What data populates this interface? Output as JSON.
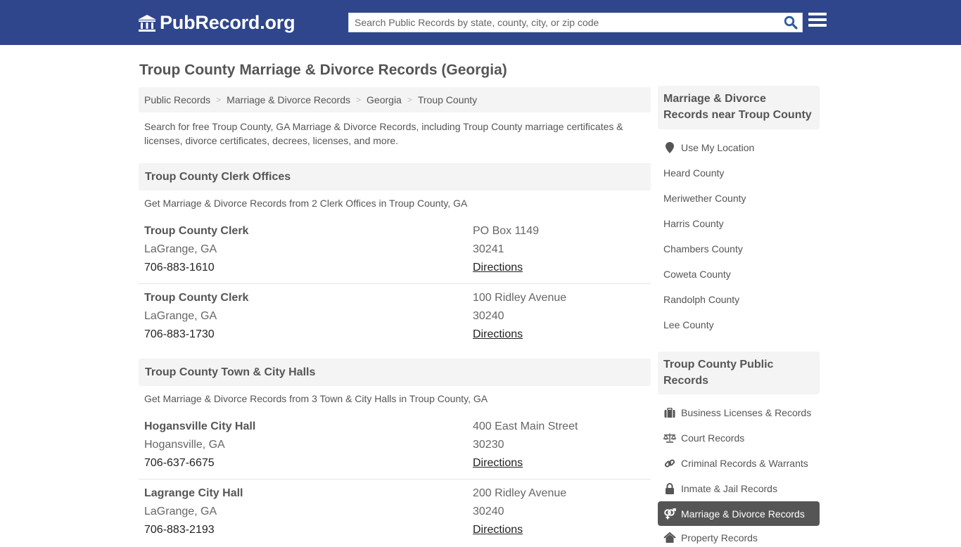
{
  "header": {
    "logo_text": "PubRecord.org",
    "search_placeholder": "Search Public Records by state, county, city, or zip code",
    "brand_color": "#2f468c"
  },
  "page_title": "Troup County Marriage & Divorce Records (Georgia)",
  "breadcrumb": [
    {
      "label": "Public Records"
    },
    {
      "label": "Marriage & Divorce Records"
    },
    {
      "label": "Georgia"
    },
    {
      "label": "Troup County"
    }
  ],
  "breadcrumb_separator": ">",
  "intro": "Search for free Troup County, GA Marriage & Divorce Records, including Troup County marriage certificates & licenses, divorce certificates, decrees, licenses, and more.",
  "sections": [
    {
      "title": "Troup County Clerk Offices",
      "subtitle": "Get Marriage & Divorce Records from 2 Clerk Offices in Troup County, GA",
      "entries": [
        {
          "name": "Troup County Clerk",
          "city": "LaGrange, GA",
          "phone": "706-883-1610",
          "address": "PO Box 1149",
          "zip": "30241",
          "directions": "Directions"
        },
        {
          "name": "Troup County Clerk",
          "city": "LaGrange, GA",
          "phone": "706-883-1730",
          "address": "100 Ridley Avenue",
          "zip": "30240",
          "directions": "Directions"
        }
      ]
    },
    {
      "title": "Troup County Town & City Halls",
      "subtitle": "Get Marriage & Divorce Records from 3 Town & City Halls in Troup County, GA",
      "entries": [
        {
          "name": "Hogansville City Hall",
          "city": "Hogansville, GA",
          "phone": "706-637-6675",
          "address": "400 East Main Street",
          "zip": "30230",
          "directions": "Directions"
        },
        {
          "name": "Lagrange City Hall",
          "city": "LaGrange, GA",
          "phone": "706-883-2193",
          "address": "200 Ridley Avenue",
          "zip": "30240",
          "directions": "Directions"
        }
      ]
    }
  ],
  "sidebar": {
    "nearby_title": "Marriage & Divorce Records near Troup County",
    "use_location": {
      "label": "Use My Location",
      "icon": "map-marker-icon"
    },
    "nearby_counties": [
      "Heard County",
      "Meriwether County",
      "Harris County",
      "Chambers County",
      "Coweta County",
      "Randolph County",
      "Lee County"
    ],
    "public_records_title": "Troup County Public Records",
    "public_records": [
      {
        "label": "Business Licenses & Records",
        "icon": "briefcase-icon"
      },
      {
        "label": "Court Records",
        "icon": "balance-scale-icon"
      },
      {
        "label": "Criminal Records & Warrants",
        "icon": "link-icon"
      },
      {
        "label": "Inmate & Jail Records",
        "icon": "lock-icon"
      },
      {
        "label": "Marriage & Divorce Records",
        "icon": "venus-mars-icon",
        "active": true
      },
      {
        "label": "Property Records",
        "icon": "home-icon"
      }
    ]
  }
}
